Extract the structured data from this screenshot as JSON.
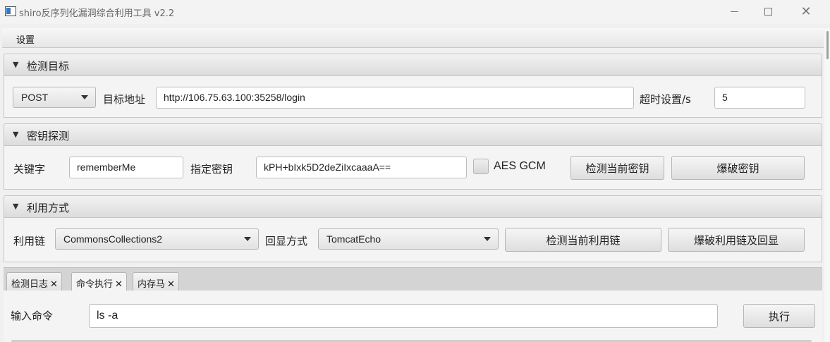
{
  "window": {
    "title": "shiro反序列化漏洞综合利用工具 v2.2",
    "minimize_icon": "minimize-icon",
    "maximize_icon": "maximize-icon",
    "close_glyph": "✕"
  },
  "menubar": {
    "items": [
      {
        "label": "设置"
      }
    ]
  },
  "target_pane": {
    "title": "检测目标",
    "collapse_glyph": "▼",
    "method": "POST",
    "url_label": "目标地址",
    "url_value": "http://106.75.63.100:35258/login",
    "timeout_label": "超时设置/s",
    "timeout_value": "5"
  },
  "key_pane": {
    "title": "密钥探测",
    "collapse_glyph": "▼",
    "keyword_label": "关键字",
    "keyword_value": "rememberMe",
    "key_label": "指定密钥",
    "key_value": "kPH+bIxk5D2deZiIxcaaaA==",
    "aes_gcm_label": "AES GCM",
    "aes_gcm_checked": false,
    "check_key_button": "检测当前密钥",
    "brute_key_button": "爆破密钥"
  },
  "exploit_pane": {
    "title": "利用方式",
    "collapse_glyph": "▼",
    "chain_label": "利用链",
    "chain_value": "CommonsCollections2",
    "echo_label": "回显方式",
    "echo_value": "TomcatEcho",
    "check_chain_button": "检测当前利用链",
    "brute_chain_button": "爆破利用链及回显"
  },
  "tabs": [
    {
      "label": "检测日志",
      "close": "✕",
      "selected": false
    },
    {
      "label": "命令执行",
      "close": "✕",
      "selected": true
    },
    {
      "label": "内存马",
      "close": "✕",
      "selected": false
    }
  ],
  "command": {
    "label": "输入命令",
    "value": "ls -a",
    "execute_button": "执行"
  },
  "colors": {
    "background": "#f0f0f0",
    "pane_header": "#dcdcdc",
    "field_border": "#bdbdbd"
  }
}
